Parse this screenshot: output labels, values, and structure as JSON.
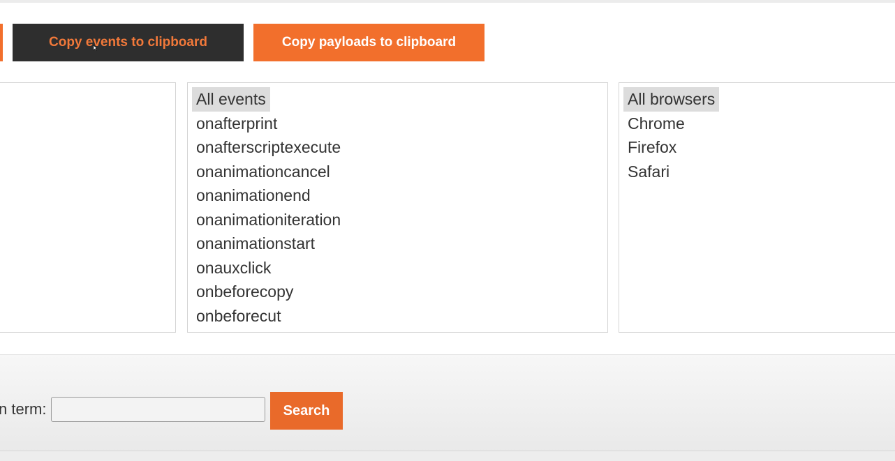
{
  "toolbar": {
    "copy_events_label": "Copy events to clipboard",
    "copy_payloads_label": "Copy payloads to clipboard"
  },
  "events_list": {
    "options": [
      "All events",
      "onafterprint",
      "onafterscriptexecute",
      "onanimationcancel",
      "onanimationend",
      "onanimationiteration",
      "onanimationstart",
      "onauxclick",
      "onbeforecopy",
      "onbeforecut"
    ],
    "selected": "All events"
  },
  "browsers_list": {
    "options": [
      "All browsers",
      "Chrome",
      "Firefox",
      "Safari"
    ],
    "selected": "All browsers"
  },
  "search": {
    "label": "n term:",
    "value": "",
    "button_label": "Search"
  },
  "colors": {
    "accent": "#f26f2c",
    "dark_button": "#2e2e2e",
    "selected_option": "#dcdcdc"
  }
}
